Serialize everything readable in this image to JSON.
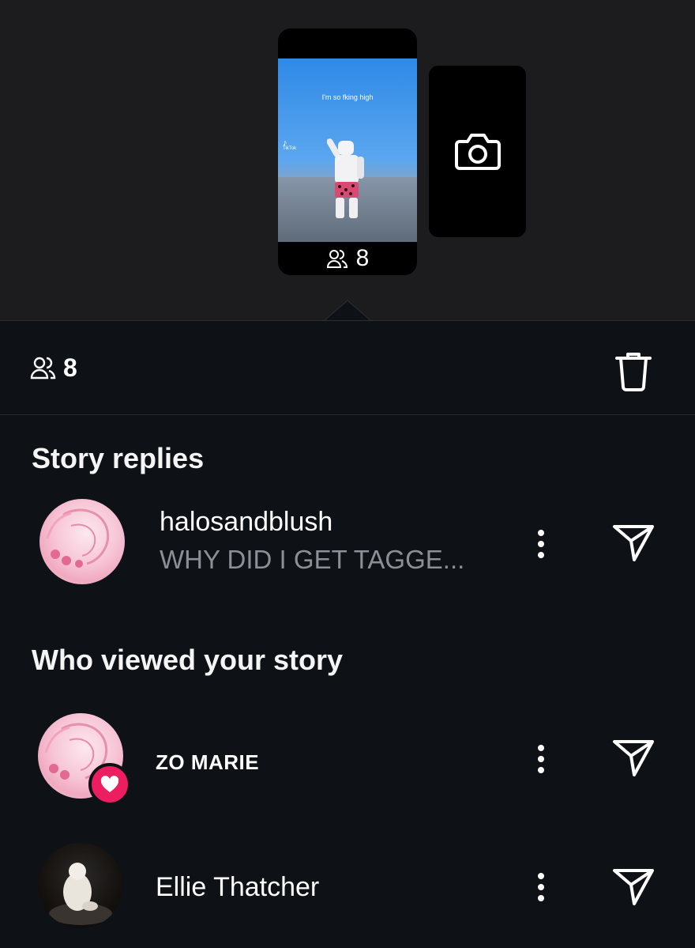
{
  "story": {
    "caption": "I'm so fking high",
    "watermark_app": "TikTok",
    "viewer_count": "8"
  },
  "sheet": {
    "viewer_count": "8",
    "story_replies_title": "Story replies",
    "viewed_title": "Who viewed your story"
  },
  "replies": [
    {
      "username": "halosandblush",
      "message": "WHY DID I GET TAGGE..."
    }
  ],
  "viewers": [
    {
      "name": "ZO MARIE",
      "liked": true
    },
    {
      "name": "Ellie Thatcher",
      "liked": false
    }
  ],
  "colors": {
    "sheet_background": "#0e1116",
    "top_background": "#1c1c1e",
    "like_badge": "#ec1d61",
    "secondary_text": "#8c8f96"
  },
  "icons": {
    "viewers": "viewers-icon",
    "camera": "camera-icon",
    "delete": "trash-icon",
    "more": "more-vertical-icon",
    "send": "send-icon",
    "heart": "heart-icon"
  }
}
